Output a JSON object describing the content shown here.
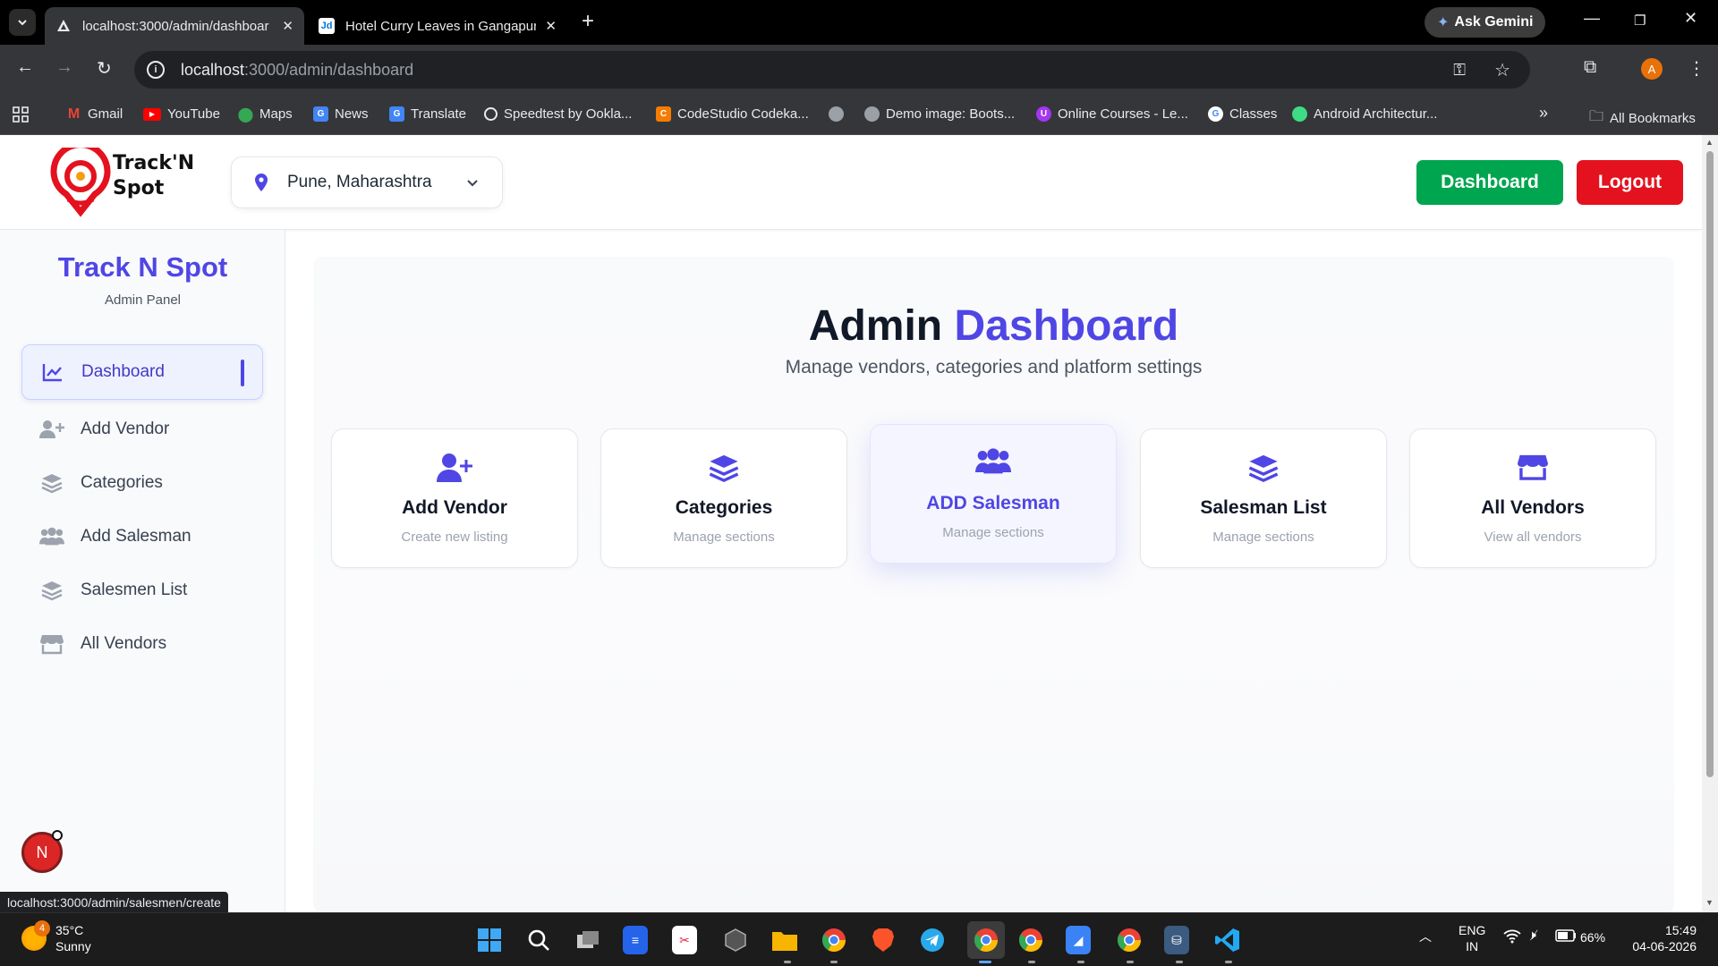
{
  "browser": {
    "tabs": [
      {
        "title": "localhost:3000/admin/dashboar",
        "active": true
      },
      {
        "title": "Hotel Curry Leaves in Gangapur",
        "active": false
      }
    ],
    "gemini_label": "Ask Gemini",
    "address": {
      "host": "localhost",
      "path": ":3000/admin/dashboard"
    },
    "profile_initial": "A",
    "bookmarks": [
      {
        "label": "Gmail",
        "icon": "gmail-icon"
      },
      {
        "label": "YouTube",
        "icon": "youtube-icon"
      },
      {
        "label": "Maps",
        "icon": "maps-icon"
      },
      {
        "label": "News",
        "icon": "news-icon"
      },
      {
        "label": "Translate",
        "icon": "translate-icon"
      },
      {
        "label": "Speedtest by Ookla...",
        "icon": "speedtest-icon"
      },
      {
        "label": "CodeStudio Codeka...",
        "icon": "codestudio-icon"
      },
      {
        "label": "Demo image: Boots...",
        "icon": "globe-icon"
      },
      {
        "label": "Online Courses - Le...",
        "icon": "udemy-icon"
      },
      {
        "label": "Classes",
        "icon": "google-icon"
      },
      {
        "label": "Android Architectur...",
        "icon": "android-icon"
      }
    ],
    "all_bookmarks": "All Bookmarks",
    "status_url": "localhost:3000/admin/salesmen/create"
  },
  "header": {
    "logo_line1": "Track'N",
    "logo_line2": "Spot",
    "location": "Pune, Maharashtra",
    "dashboard_btn": "Dashboard",
    "logout_btn": "Logout"
  },
  "sidebar": {
    "title": "Track N Spot",
    "subtitle": "Admin Panel",
    "items": [
      {
        "label": "Dashboard",
        "icon": "chart-line-icon",
        "active": true
      },
      {
        "label": "Add Vendor",
        "icon": "user-plus-icon"
      },
      {
        "label": "Categories",
        "icon": "layers-icon"
      },
      {
        "label": "Add Salesman",
        "icon": "users-icon"
      },
      {
        "label": "Salesmen List",
        "icon": "layers-icon"
      },
      {
        "label": "All Vendors",
        "icon": "store-icon"
      }
    ]
  },
  "main": {
    "title_part1": "Admin",
    "title_part2": "Dashboard",
    "subtitle": "Manage vendors, categories and platform settings",
    "cards": [
      {
        "title": "Add Vendor",
        "subtitle": "Create new listing",
        "icon": "user-plus-icon"
      },
      {
        "title": "Categories",
        "subtitle": "Manage sections",
        "icon": "layers-icon"
      },
      {
        "title": "ADD Salesman",
        "subtitle": "Manage sections",
        "icon": "users-icon"
      },
      {
        "title": "Salesman List",
        "subtitle": "Manage sections",
        "icon": "layers-icon"
      },
      {
        "title": "All Vendors",
        "subtitle": "View all vendors",
        "icon": "store-icon"
      }
    ]
  },
  "next_badge": "N",
  "taskbar": {
    "weather_temp": "35°C",
    "weather_desc": "Sunny",
    "weather_badge": "4",
    "lang_line1": "ENG",
    "lang_line2": "IN",
    "battery": "66%",
    "time": "15:49",
    "date": "04-06-2026"
  },
  "colors": {
    "accent": "#4f46e5",
    "dashboard_btn": "#00a54f",
    "logout_btn": "#e3121e"
  }
}
